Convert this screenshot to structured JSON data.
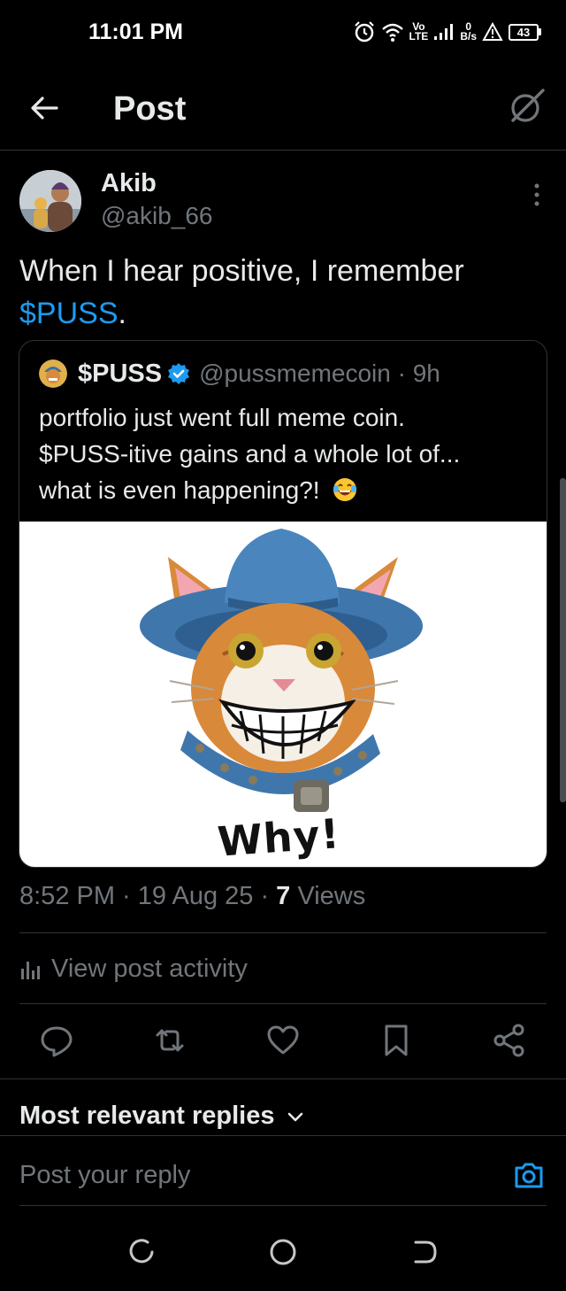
{
  "status_bar": {
    "time": "11:01 PM",
    "network_top": "Vo",
    "network_bottom": "LTE",
    "data_rate_value": "0",
    "data_rate_unit": "B/s",
    "battery": "43",
    "icons": [
      "alarm-icon",
      "wifi-icon",
      "signal-icon",
      "alert-icon",
      "battery-icon"
    ]
  },
  "header": {
    "back_icon": "arrow-left-icon",
    "title": "Post",
    "grok_icon": "grok-icon"
  },
  "post": {
    "author_name": "Akib",
    "author_handle": "@akib_66",
    "text_before": "When I hear positive, I remember",
    "cashtag": "$PUSS",
    "text_after": ".",
    "quoted": {
      "name": "$PUSS",
      "handle_time": "@pussmemecoin · 9h",
      "line1": "portfolio just went full meme coin.",
      "line2": "$PUSS-itive gains and a whole lot of...",
      "line3": "what is even happening?!",
      "image_caption": "Why!"
    },
    "timestamp": "8:52 PM · 19 Aug 25 · ",
    "views_count": "7",
    "views_label": " Views"
  },
  "activity": {
    "label": "View post activity"
  },
  "actions": [
    "reply-icon",
    "repost-icon",
    "like-icon",
    "bookmark-icon",
    "share-icon"
  ],
  "replies": {
    "sort_label": "Most relevant replies",
    "reply_placeholder": "Post your reply"
  },
  "colors": {
    "background": "#000000",
    "text_primary": "#e7e9ea",
    "text_secondary": "#71767b",
    "accent": "#1d9bf0",
    "border": "#2f3336"
  }
}
